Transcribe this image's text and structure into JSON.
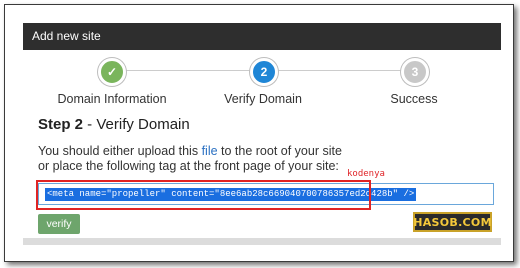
{
  "header": {
    "title": "Add new site"
  },
  "stepper": {
    "steps": [
      {
        "number": "✓",
        "label": "Domain Information",
        "state": "done"
      },
      {
        "number": "2",
        "label": "Verify Domain",
        "state": "active"
      },
      {
        "number": "3",
        "label": "Success",
        "state": "todo"
      }
    ]
  },
  "step_title": {
    "prefix": "Step 2",
    "text": " - Verify Domain"
  },
  "instructions": {
    "line1_before": "You should either upload this ",
    "link": "file",
    "line1_after": " to the root of your site",
    "line2": "or place the following tag at the front page of your site:"
  },
  "annotation": {
    "note": "kodenya"
  },
  "meta_tag": {
    "value": "<meta name=\"propeller\" content=\"8ee6ab28c669040700786357ed2d428b\" />"
  },
  "verify_button": {
    "label": "verify"
  },
  "watermark": {
    "text": "HASOB.COM"
  },
  "colors": {
    "header_bg": "#2e2e2e",
    "done": "#7ab55c",
    "active": "#1f86d6",
    "todo": "#c8c8c8",
    "link": "#2a70c2",
    "annotation": "#e0262a",
    "button": "#6ea56c"
  }
}
